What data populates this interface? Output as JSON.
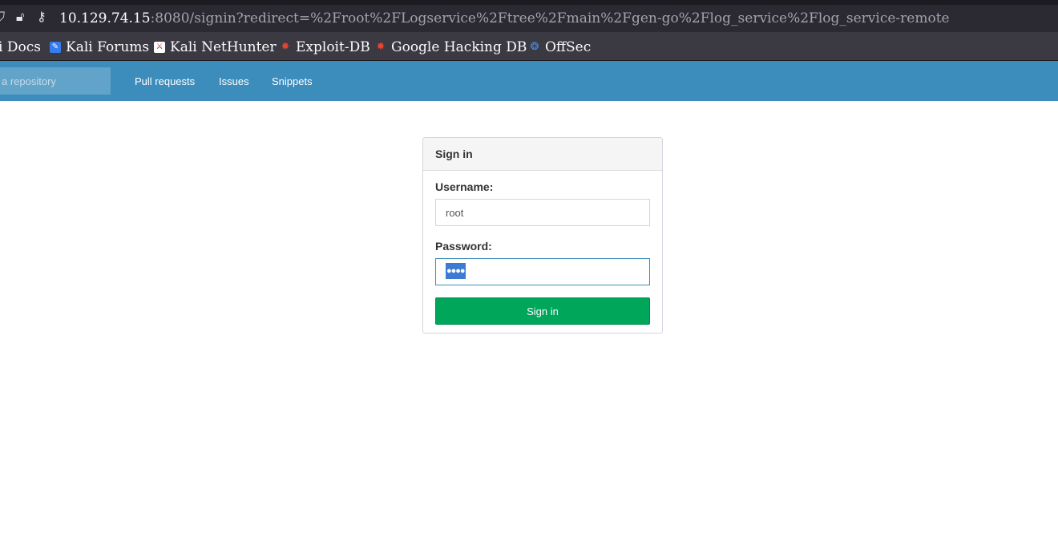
{
  "browser": {
    "url_host": "10.129.74.15",
    "url_rest": ":8080/signin?redirect=%2Froot%2FLogservice%2Ftree%2Fmain%2Fgen-go%2Flog_service%2Flog_service-remote",
    "bookmarks": [
      {
        "label": "i Docs",
        "icon": "kali-docs-icon"
      },
      {
        "label": "Kali Forums",
        "icon": "kali-forums-icon"
      },
      {
        "label": "Kali NetHunter",
        "icon": "kali-nethunter-icon"
      },
      {
        "label": "Exploit-DB",
        "icon": "exploit-db-icon"
      },
      {
        "label": "Google Hacking DB",
        "icon": "ghdb-icon"
      },
      {
        "label": "OffSec",
        "icon": "offsec-icon"
      }
    ]
  },
  "nav": {
    "search_placeholder": "a repository",
    "links": [
      "Pull requests",
      "Issues",
      "Snippets"
    ],
    "color": "#3c8dbc"
  },
  "signin": {
    "title": "Sign in",
    "username_label": "Username:",
    "username_value": "root",
    "password_label": "Password:",
    "password_mask": "●●●●",
    "submit_label": "Sign in",
    "submit_color": "#00a65a"
  }
}
